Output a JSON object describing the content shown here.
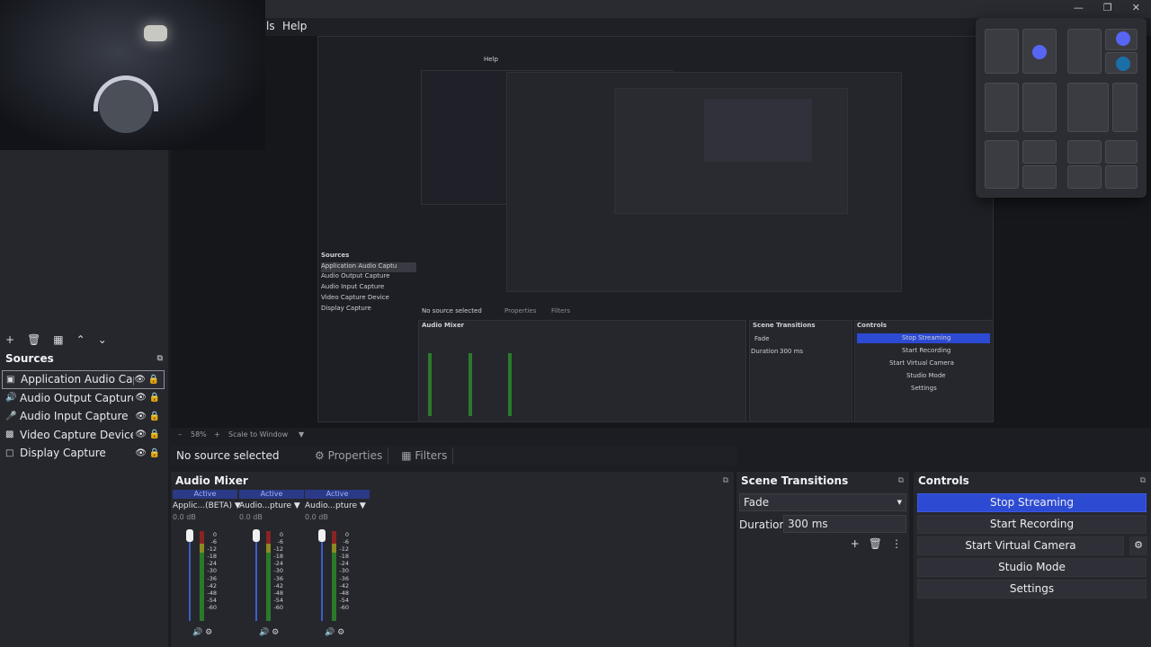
{
  "window": {
    "controls": [
      "minimize",
      "restore",
      "close"
    ],
    "menu_visible": [
      "ls",
      "Help"
    ]
  },
  "preview": {
    "nested_menu": [
      "Help"
    ],
    "nested_sources_title": "Sources",
    "nested_sources": [
      "Application Audio Captu",
      "Audio Output Capture",
      "Audio Input Capture",
      "Video Capture Device",
      "Display Capture"
    ],
    "nested_no_source": "No source selected",
    "nested_properties": "Properties",
    "nested_filters": "Filters",
    "nested_mixer": "Audio Mixer",
    "nested_transitions": "Scene Transitions",
    "nested_fade": "Fade",
    "nested_duration": "Duration",
    "nested_duration_value": "300 ms",
    "nested_controls": "Controls",
    "nested_stop": "Stop Streaming",
    "nested_start_rec": "Start Recording",
    "nested_virtual": "Start Virtual Camera",
    "nested_studio": "Studio Mode",
    "nested_settings": "Settings"
  },
  "zoom": {
    "value": "58%",
    "mode": "Scale to Window"
  },
  "sources": {
    "title": "Sources",
    "items": [
      {
        "label": "Application Audio Captu",
        "icon": "app-audio-icon",
        "selected": true
      },
      {
        "label": "Audio Output Capture",
        "icon": "speaker-icon",
        "selected": false
      },
      {
        "label": "Audio Input Capture",
        "icon": "microphone-icon",
        "selected": false
      },
      {
        "label": "Video Capture Device",
        "icon": "camera-icon",
        "selected": false
      },
      {
        "label": "Display Capture",
        "icon": "monitor-icon",
        "selected": false
      }
    ]
  },
  "context": {
    "no_source": "No source selected",
    "properties": "Properties",
    "filters": "Filters"
  },
  "mixer": {
    "title": "Audio Mixer",
    "channels": [
      {
        "status": "Active",
        "name": "Applic...(BETA)",
        "db": "0.0 dB"
      },
      {
        "status": "Active",
        "name": "Audio...pture",
        "db": "0.0 dB"
      },
      {
        "status": "Active",
        "name": "Audio...pture",
        "db": "0.0 dB"
      }
    ],
    "scale": [
      "0",
      "-6",
      "-12",
      "-18",
      "-24",
      "-30",
      "-36",
      "-42",
      "-48",
      "-54",
      "-60"
    ]
  },
  "transitions": {
    "title": "Scene Transitions",
    "selected": "Fade",
    "duration_label": "Duration",
    "duration_value": "300 ms"
  },
  "controls": {
    "title": "Controls",
    "stop_streaming": "Stop Streaming",
    "start_recording": "Start Recording",
    "start_virtual_camera": "Start Virtual Camera",
    "studio_mode": "Studio Mode",
    "settings": "Settings"
  },
  "colors": {
    "accent": "#2d4ad3",
    "panel": "#26272d",
    "background": "#1c1d22"
  }
}
